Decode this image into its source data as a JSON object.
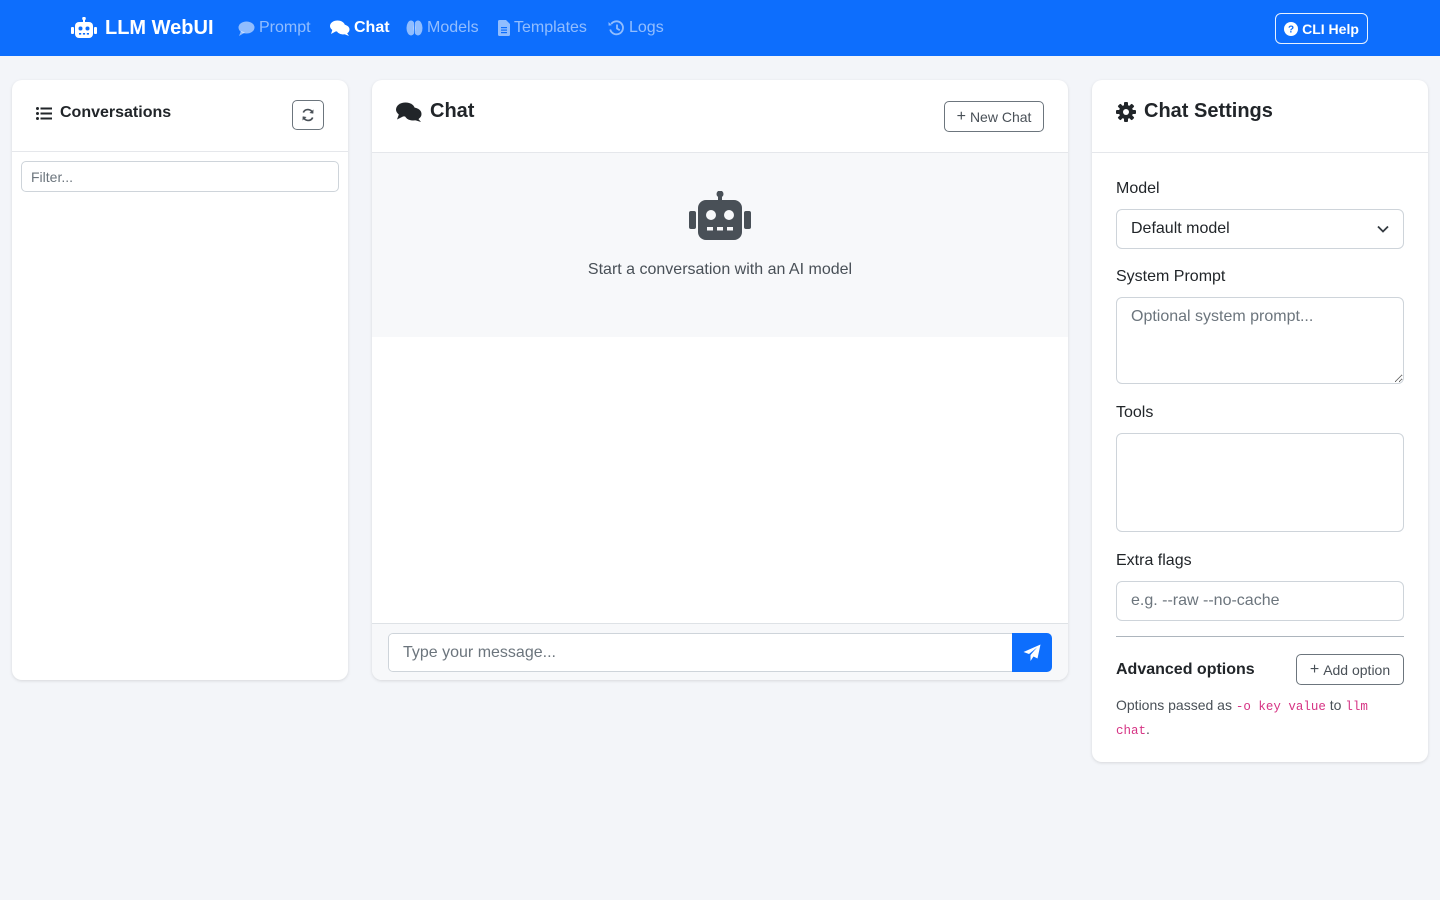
{
  "navbar": {
    "brand": "LLM WebUI",
    "brand_icon": "robot-icon",
    "links": [
      {
        "label": "Prompt",
        "icon": "comment-icon",
        "active": false
      },
      {
        "label": "Chat",
        "icon": "comments-icon",
        "active": true
      },
      {
        "label": "Models",
        "icon": "brain-icon",
        "active": false
      },
      {
        "label": "Templates",
        "icon": "file-icon",
        "active": false
      },
      {
        "label": "Logs",
        "icon": "history-icon",
        "active": false
      }
    ],
    "cli_help": "CLI Help",
    "accent_color": "#0d6efd"
  },
  "conversations": {
    "title": "Conversations",
    "filter_placeholder": "Filter..."
  },
  "chat": {
    "title": "Chat",
    "new_chat_label": "New Chat",
    "empty_text": "Start a conversation with an AI model",
    "message_placeholder": "Type your message..."
  },
  "settings": {
    "title": "Chat Settings",
    "model_label": "Model",
    "model_selected": "Default model",
    "system_prompt_label": "System Prompt",
    "system_prompt_placeholder": "Optional system prompt...",
    "tools_label": "Tools",
    "extra_flags_label": "Extra flags",
    "extra_flags_placeholder": "e.g. --raw --no-cache",
    "advanced_title": "Advanced options",
    "add_option_label": "Add option",
    "help_prefix": "Options passed as ",
    "help_code1": "-o key value",
    "help_mid": " to ",
    "help_code2": "llm chat",
    "help_suffix": "."
  }
}
